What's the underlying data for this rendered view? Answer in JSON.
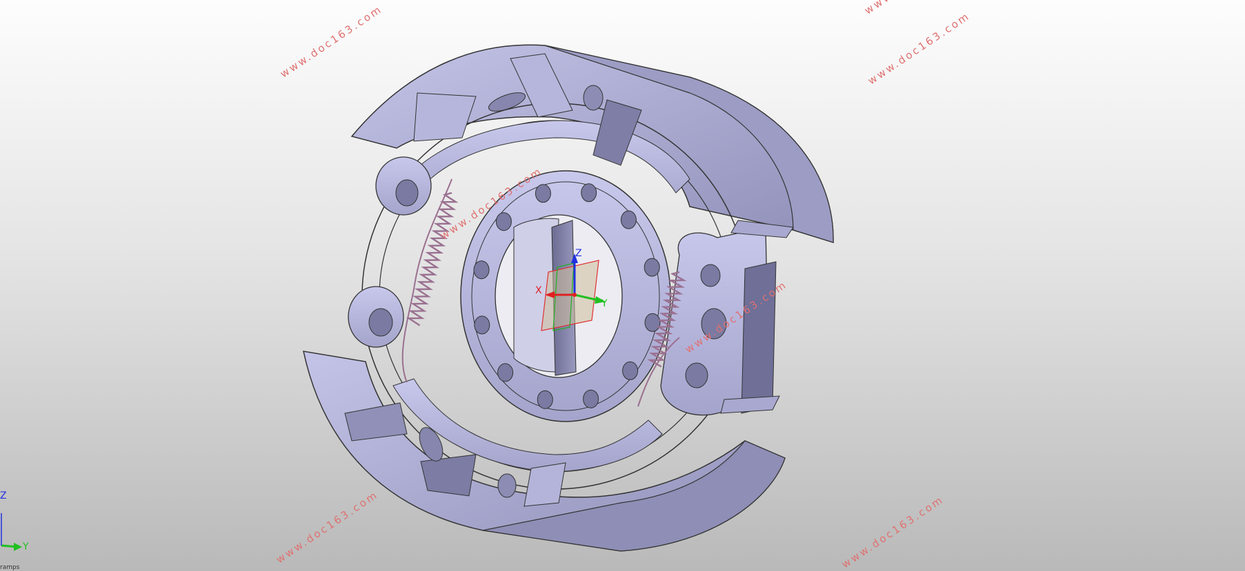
{
  "viewport": {
    "model": "brake-assembly",
    "background_top": "#fdfdfd",
    "background_bottom": "#b9b9b9",
    "part_color": "#b0b0d8",
    "spring_color": "#b08ca8"
  },
  "origin_axes": {
    "x_label": "X",
    "y_label": "Y",
    "z_label": "Z",
    "x_color": "#e02020",
    "y_color": "#20c020",
    "z_color": "#2030e0"
  },
  "corner_triad": {
    "z_label": "Z",
    "y_label": "Y"
  },
  "watermarks": [
    "www.doc163.com",
    "www.doc163.com",
    "www.doc163.com",
    "www.doc163.com",
    "www.doc163.com",
    "www.doc163.com",
    "www.doc163.com"
  ],
  "status": {
    "text": "ramps"
  }
}
